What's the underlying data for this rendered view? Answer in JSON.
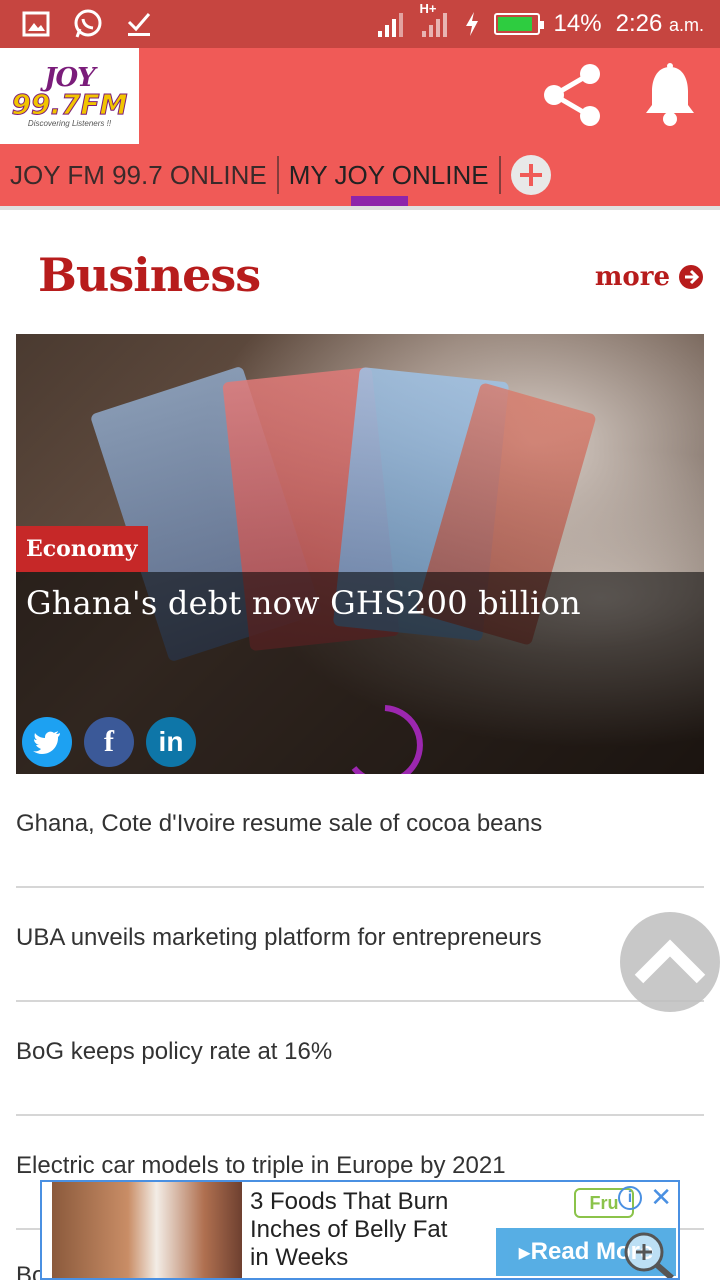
{
  "status_bar": {
    "network": "H+",
    "battery_percent": "14%",
    "battery_level": 0.85,
    "time": "2:26",
    "ampm": "a.m."
  },
  "header": {
    "logo_name": "JOY",
    "logo_freq": "99.7FM",
    "logo_tagline": "Discovering Listeners !!"
  },
  "tabs": [
    {
      "label": "JOY FM 99.7 ONLINE",
      "active": false
    },
    {
      "label": "MY JOY ONLINE",
      "active": true
    }
  ],
  "section": {
    "title": "Business",
    "more_label": "more"
  },
  "hero": {
    "category": "Economy",
    "headline": "Ghana's debt now GHS200 billion"
  },
  "news": [
    {
      "title": "Ghana, Cote d'Ivoire resume sale of cocoa beans"
    },
    {
      "title": "UBA unveils marketing platform for entrepreneurs"
    },
    {
      "title": "BoG keeps policy rate at 16%"
    },
    {
      "title": "Electric car models to triple in Europe by 2021"
    }
  ],
  "bottom_peek": "Bo",
  "ad": {
    "line1": "3 Foods That Burn",
    "line2": "Inches of Belly Fat",
    "line3": "in Weeks",
    "cta": "Read More",
    "brand": "Fru"
  },
  "colors": {
    "status_bar": "#c64540",
    "header": "#f05a57",
    "accent_purple": "#8e24aa",
    "section_red": "#b71c1c",
    "badge_red": "#c62828"
  }
}
